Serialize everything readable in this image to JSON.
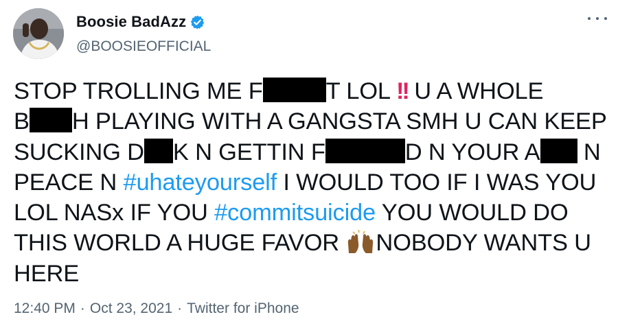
{
  "author": {
    "display_name": "Boosie BadAzz",
    "handle": "@BOOSIEOFFICIAL",
    "verified_icon": "verified-badge-icon",
    "avatar_icon": "profile-avatar"
  },
  "more_icon": "more-options-icon",
  "tweet": {
    "line1_a": "STOP TROLLING ME F",
    "line1_b": "T LOL ",
    "line1_bangs": "!!",
    "line1_c": " U A WHOLE",
    "line2_a": "B",
    "line2_b": "H PLAYING WITH A GANGSTA SMH U CAN KEEP",
    "line3_a": "SUCKING D",
    "line3_b": "K N GETTIN F",
    "line3_c": "D N YOUR A",
    "line3_d": " N",
    "line4_a": "PEACE N ",
    "line4_hashtag": "#uhateyourself",
    "line4_b": " I WOULD TOO IF I WAS YOU",
    "line5_a": "LOL NASx IF YOU ",
    "line5_hashtag": "#commitsuicide",
    "line5_b": " YOU WOULD DO",
    "line6_a": "THIS WORLD A HUGE FAVOR ",
    "line6_emoji": "raising-hands-emoji",
    "line6_b": "NOBODY WANTS U",
    "line7": "HERE"
  },
  "meta": {
    "time": "12:40 PM",
    "separator": "·",
    "date": "Oct 23, 2021",
    "source": "Twitter for iPhone"
  },
  "colors": {
    "text": "#0f1419",
    "secondary": "#536471",
    "link": "#1d9bf0",
    "verified": "#1d9bf0"
  }
}
